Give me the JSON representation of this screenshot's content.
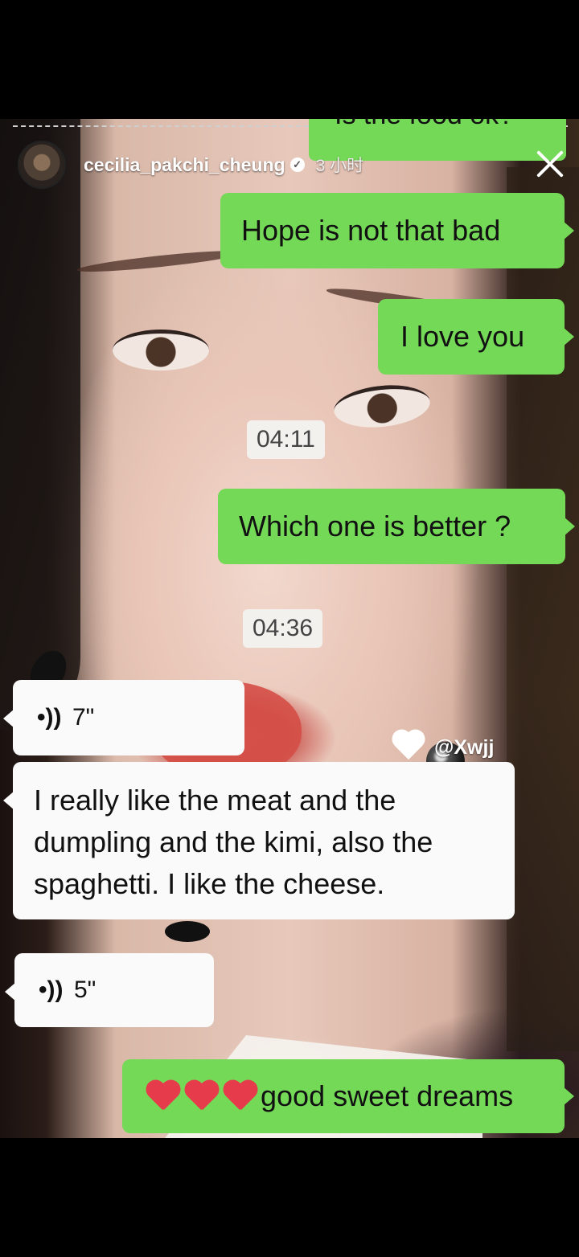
{
  "story": {
    "username": "cecilia_pakchi_cheung",
    "time_ago": "3 小时",
    "verified_icon": "verified-check-icon",
    "close_icon": "close-icon"
  },
  "chat": {
    "top_partial_message": "Is the food ok?",
    "messages": [
      {
        "side": "right",
        "text": "Hope is not that bad"
      },
      {
        "side": "right",
        "text": "I love you"
      },
      {
        "side": "center",
        "text": "04:11"
      },
      {
        "side": "right",
        "text": "Which one is better ?"
      },
      {
        "side": "center",
        "text": "04:36"
      },
      {
        "side": "left",
        "type": "voice",
        "text": "7\""
      },
      {
        "side": "left",
        "text": "I really like the meat and the dumpling and the kimi, also the spaghetti. I like the cheese."
      },
      {
        "side": "left",
        "type": "voice",
        "text": "5\""
      },
      {
        "side": "right",
        "text": "good sweet dreams",
        "emoji": [
          "red-heart",
          "red-heart",
          "red-heart"
        ]
      }
    ]
  },
  "watermark": {
    "handle": "@Xwjj"
  },
  "colors": {
    "green_bubble": "#75d958",
    "white_bubble": "#fafafa",
    "background": "#000000"
  }
}
